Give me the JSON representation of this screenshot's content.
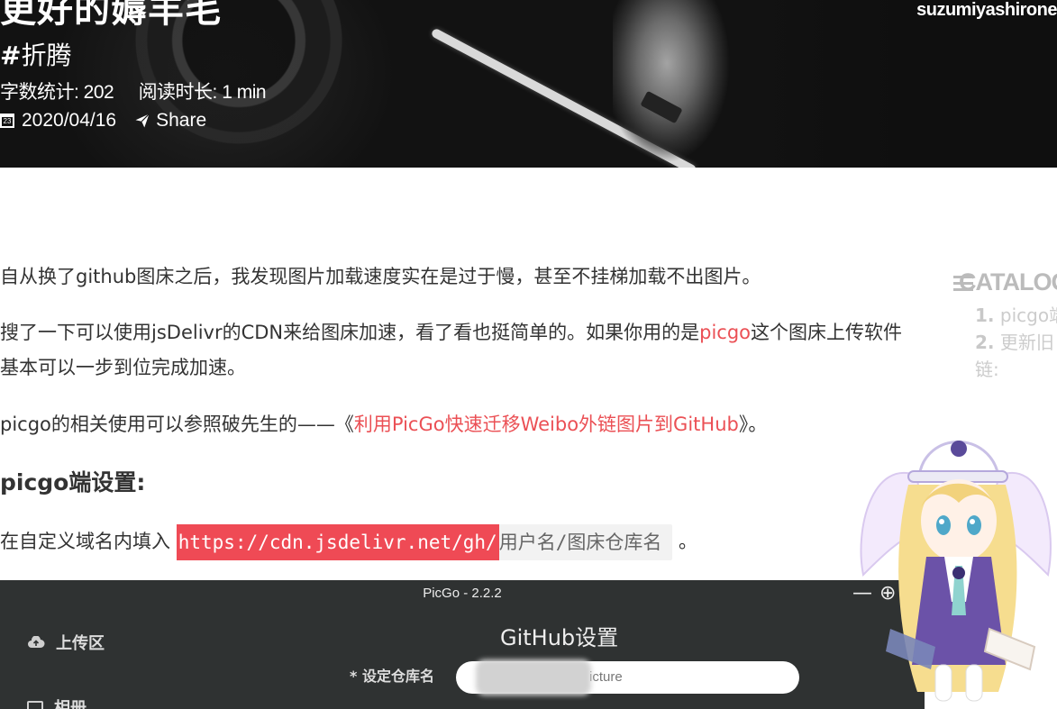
{
  "banner": {
    "title": "更好的薅羊毛",
    "tag_hash": "#",
    "tag": "折腾",
    "word_count_label": "字数统计: 202",
    "read_time_label": "阅读时长: 1 min",
    "date": "2020/04/16",
    "share_label": "Share",
    "author": "suzumiyashirone"
  },
  "article": {
    "p1": "自从换了github图床之后，我发现图片加载速度实在是过于慢，甚至不挂梯加载不出图片。",
    "p2_before": "搜了一下可以使用jsDelivr的CDN来给图床加速，看了看也挺简单的。如果你用的是",
    "p2_link": "picgo",
    "p2_after": "这个图床上传软件基本可以一步到位完成加速。",
    "p3_before": "picgo的相关使用可以参照破先生的——《",
    "p3_link": "利用PicGo快速迁移Weibo外链图片到GitHub",
    "p3_after": "》。",
    "h3": "picgo端设置:",
    "p4_before": "在自定义域名内填入",
    "p4_code_highlight": "https://cdn.jsdelivr.net/gh/",
    "p4_code_rest": "用户名/图床仓库名",
    "p4_after": "。"
  },
  "catalog": {
    "title": "CATALOG",
    "items": [
      {
        "num": "1.",
        "text": "picgo端"
      },
      {
        "num": "2.",
        "text": "更新旧"
      },
      {
        "num": "",
        "text": "链:"
      }
    ]
  },
  "picgo_window": {
    "title": "PicGo - 2.2.2",
    "controls": [
      "—",
      "⊕",
      "✕"
    ],
    "sidebar": [
      {
        "label": "上传区",
        "icon": "cloud-upload-icon"
      },
      {
        "label": "相册",
        "icon": "album-icon"
      }
    ],
    "panel_title": "GitHub设置",
    "repo_label": "* 设定仓库名",
    "repo_value": "icture"
  },
  "colors": {
    "link": "#eb5055",
    "code_highlight_bg": "#ef4a55",
    "picgo_bg": "#2f3232"
  }
}
